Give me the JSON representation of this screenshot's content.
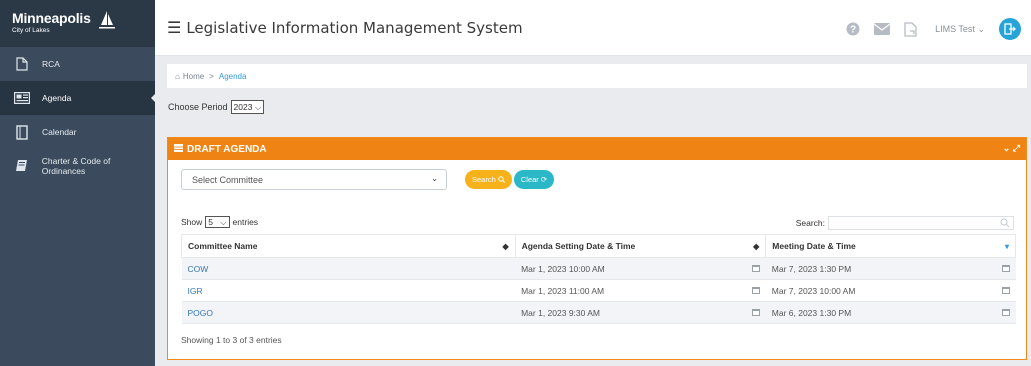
{
  "brand": {
    "name": "Minneapolis",
    "subtitle": "City of Lakes"
  },
  "sidebar": {
    "items": [
      {
        "label": "RCA",
        "icon": "document-icon"
      },
      {
        "label": "Agenda",
        "icon": "newspaper-icon",
        "active": true
      },
      {
        "label": "Calendar",
        "icon": "calendar-icon"
      },
      {
        "label": "Charter & Code of Ordinances",
        "icon": "book-icon"
      }
    ]
  },
  "header": {
    "title": "Legislative Information Management System",
    "user": "LIMS Test"
  },
  "breadcrumb": {
    "home": "Home",
    "separator": ">",
    "current": "Agenda"
  },
  "period": {
    "label": "Choose Period",
    "value": "2023"
  },
  "panel": {
    "title": "DRAFT AGENDA",
    "committee_select": "Select Committee",
    "search_button": "Search",
    "clear_button": "Clear"
  },
  "table": {
    "show_label": "Show",
    "page_size": "5",
    "entries_label": "entries",
    "search_label": "Search:",
    "columns": [
      "Committee Name",
      "Agenda Setting Date & Time",
      "Meeting Date & Time"
    ],
    "rows": [
      {
        "name": "COW",
        "agenda": "Mar 1, 2023 10:00 AM",
        "meeting": "Mar 7, 2023 1:30 PM"
      },
      {
        "name": "IGR",
        "agenda": "Mar 1, 2023 11:00 AM",
        "meeting": "Mar 7, 2023 10:00 AM"
      },
      {
        "name": "POGO",
        "agenda": "Mar 1, 2023 9:30 AM",
        "meeting": "Mar 6, 2023 1:30 PM"
      }
    ],
    "info": "Showing 1 to 3 of 3 entries"
  },
  "colors": {
    "accent": "#ef8313",
    "sidebar": "#3b4b5d",
    "link": "#3478b7",
    "search_btn": "#f7b11a",
    "clear_btn": "#2ab8c9"
  }
}
